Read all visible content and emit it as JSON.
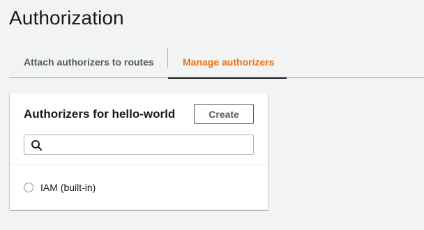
{
  "page": {
    "title": "Authorization"
  },
  "tabs": [
    {
      "label": "Attach authorizers to routes",
      "active": false
    },
    {
      "label": "Manage authorizers",
      "active": true
    }
  ],
  "authorizers_panel": {
    "title": "Authorizers for hello-world",
    "create_label": "Create",
    "search": {
      "value": "",
      "placeholder": ""
    },
    "items": [
      {
        "label": "IAM (built-in)",
        "selected": false
      }
    ]
  },
  "colors": {
    "background": "#f2f3f3",
    "active_tab": "#ec7211",
    "text": "#16191f",
    "muted": "#545b64"
  },
  "icons": {
    "search": "search-icon",
    "radio": "radio-unchecked"
  }
}
